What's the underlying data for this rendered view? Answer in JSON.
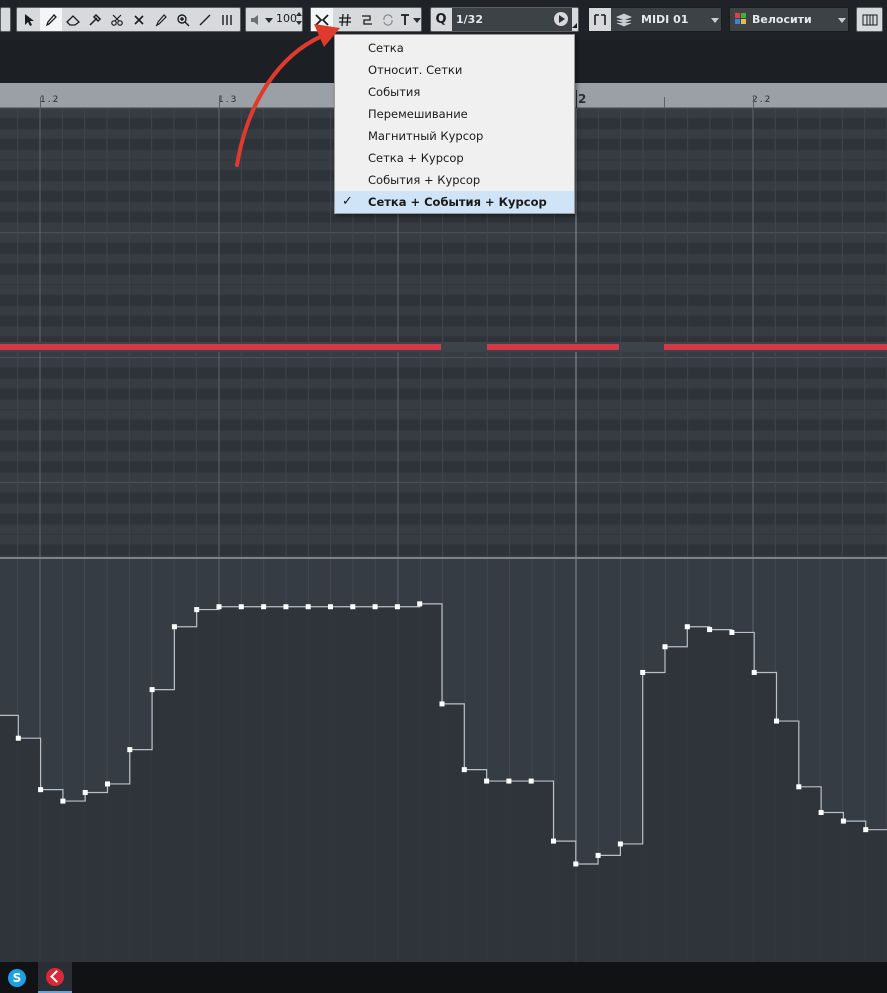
{
  "toolbar": {
    "velocity_value": "100",
    "quantize_value": "1/32",
    "track_name": "MIDI 01",
    "controller_lane": "Велосити",
    "icons": [
      "object-select-icon",
      "draw-icon",
      "erase-icon",
      "trim-icon",
      "split-icon",
      "glue-icon",
      "mute-icon",
      "zoom-icon",
      "line-icon",
      "time-warp-icon",
      "speaker-icon",
      "snap-toggle-icon",
      "grid-icon",
      "snap-type-icon",
      "cycle-icon",
      "quantize-icon",
      "play-icon",
      "bars-icon",
      "layers-icon",
      "color-grid-icon",
      "piano-icon"
    ]
  },
  "ruler": {
    "labels": [
      "1.2",
      "1.3",
      "2",
      "2.2"
    ]
  },
  "snap_menu": {
    "items": [
      {
        "label": "Сетка",
        "checked": false
      },
      {
        "label": "Относит. Сетки",
        "checked": false
      },
      {
        "label": "События",
        "checked": false
      },
      {
        "label": "Перемешивание",
        "checked": false
      },
      {
        "label": "Магнитный Курсор",
        "checked": false
      },
      {
        "label": "Сетка + Курсор",
        "checked": false
      },
      {
        "label": "События + Курсор",
        "checked": false
      },
      {
        "label": "Сетка + События + Курсор",
        "checked": true
      }
    ],
    "check_glyph": "✓"
  },
  "notes": {
    "color": "#d23a4a",
    "segments": [
      [
        0,
        441
      ],
      [
        487,
        619
      ],
      [
        664,
        887
      ]
    ]
  },
  "velocity": {
    "values": [
      80,
      72,
      54,
      50,
      53,
      56,
      68,
      89,
      111,
      117,
      118,
      118,
      118,
      118,
      118,
      118,
      118,
      118,
      118,
      119,
      84,
      61,
      57,
      57,
      57,
      36,
      28,
      31,
      35,
      95,
      104,
      111,
      110,
      109,
      95,
      78,
      55,
      46,
      43,
      40,
      38,
      35
    ]
  },
  "taskbar": {
    "items": [
      "skype-icon",
      "cubase-icon"
    ]
  },
  "colors": {
    "accent_red": "#e03a2c",
    "menu_check_bg": "#cfe4f7"
  }
}
